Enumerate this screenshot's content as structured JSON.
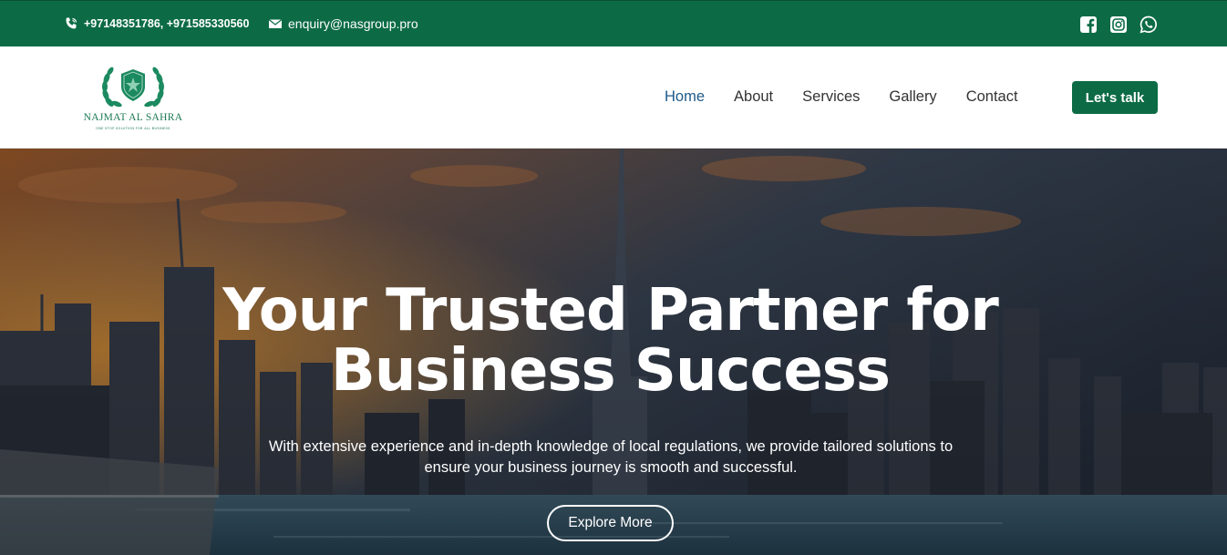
{
  "topbar": {
    "phone": "+97148351786, +971585330560",
    "email": "enquiry@nasgroup.pro",
    "icons": [
      "phone-icon",
      "mail-icon",
      "facebook-icon",
      "instagram-icon",
      "whatsapp-icon"
    ]
  },
  "logo": {
    "title": "NAJMAT AL SAHRA",
    "tagline": "ONE STOP SOLUTION FOR ALL BUSINESS"
  },
  "nav": {
    "items": [
      "Home",
      "About",
      "Services",
      "Gallery",
      "Contact"
    ],
    "active": "Home",
    "cta": "Let's talk"
  },
  "hero": {
    "title_line1": "Your Trusted Partner for",
    "title_line2": "Business Success",
    "description_line1": "With extensive experience and in-depth knowledge of local regulations, we provide tailored solutions to",
    "description_line2": "ensure your business journey is smooth and successful.",
    "button": "Explore More"
  },
  "colors": {
    "brand_green": "#0c6b45",
    "nav_active": "#1e5a8a",
    "nav_text": "#333333"
  }
}
